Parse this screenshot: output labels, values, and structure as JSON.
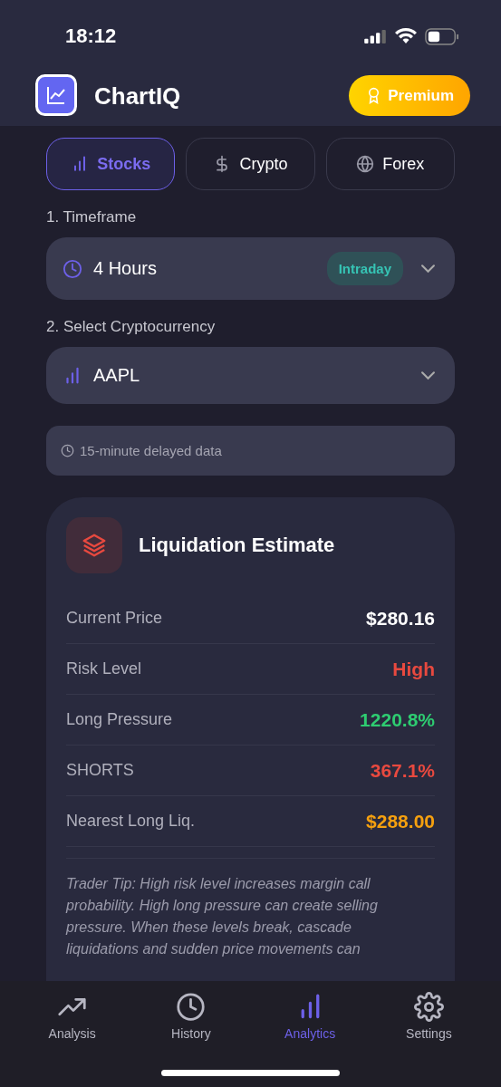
{
  "status_bar": {
    "time": "18:12"
  },
  "header": {
    "title": "ChartIQ",
    "premium_button": "Premium"
  },
  "market_tabs": [
    {
      "label": "Stocks",
      "kind": "bars",
      "selected": true
    },
    {
      "label": "Crypto",
      "kind": "dollar",
      "selected": false
    },
    {
      "label": "Forex",
      "kind": "globe",
      "selected": false
    }
  ],
  "timeframe": {
    "label": "1. Timeframe",
    "value": "4 Hours",
    "badge": "Intraday"
  },
  "symbol": {
    "label": "2. Select Cryptocurrency",
    "value": "AAPL"
  },
  "notice": "15-minute delayed data",
  "liquidation_card": {
    "title": "Liquidation Estimate",
    "rows": [
      {
        "label": "Current Price",
        "value": "$280.16",
        "color": "#ffffff"
      },
      {
        "label": "Risk Level",
        "value": "High",
        "color": "#e8493f"
      },
      {
        "label": "Long Pressure",
        "value": "1220.8%",
        "color": "#2ecc71"
      },
      {
        "label": "SHORTS",
        "value": "367.1%",
        "color": "#e8493f"
      },
      {
        "label": "Nearest Long Liq.",
        "value": "$288.00",
        "color": "#f5a00f"
      }
    ],
    "tip": "Trader Tip: High risk level increases margin call probability. High long pressure can create selling pressure. When these levels break, cascade liquidations and sudden price movements can"
  },
  "tab_bar": [
    {
      "label": "Analysis",
      "kind": "trend",
      "selected": false
    },
    {
      "label": "History",
      "kind": "clock",
      "selected": false
    },
    {
      "label": "Analytics",
      "kind": "bars",
      "selected": true
    },
    {
      "label": "Settings",
      "kind": "gear",
      "selected": false
    }
  ]
}
